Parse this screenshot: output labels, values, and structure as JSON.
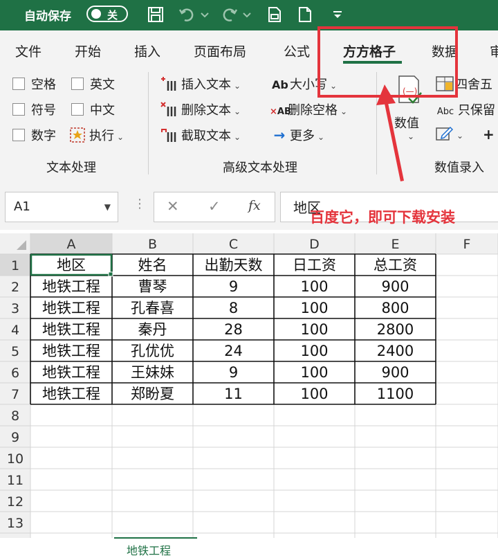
{
  "title_bar": {
    "autosave_label": "自动保存",
    "autosave_state": "关",
    "icons": [
      "save-icon",
      "undo-icon",
      "redo-icon",
      "print-icon",
      "new-file-icon",
      "more-icon"
    ]
  },
  "tabs": [
    {
      "label": "文件"
    },
    {
      "label": "开始"
    },
    {
      "label": "插入"
    },
    {
      "label": "页面布局"
    },
    {
      "label": "公式"
    },
    {
      "label": "方方格子",
      "active": true
    },
    {
      "label": "数据"
    },
    {
      "label": "审"
    }
  ],
  "ribbon": {
    "text_group": {
      "label": "文本处理",
      "checks": [
        "空格",
        "英文",
        "符号",
        "中文",
        "数字"
      ],
      "execute_label": "执行"
    },
    "advanced_group": {
      "label": "高级文本处理",
      "insert_text": "插入文本",
      "delete_text": "删除文本",
      "extract_text": "截取文本",
      "case_label": "大小写",
      "case_icon_text": "Ab",
      "delete_space": "删除空格",
      "delete_space_icon_text": "AB",
      "more_label": "更多"
    },
    "value_group": {
      "label": "数值录入",
      "value_label": "数值",
      "round_label": "四舍五",
      "keep_label": "只保留",
      "keep_icon_text": "Abc",
      "plus_label": "+"
    }
  },
  "formula_bar": {
    "name_box": "A1",
    "fx": "fx",
    "value": "地区"
  },
  "annotation": {
    "text": "百度它，即可下载安装",
    "color": "#e4343c"
  },
  "sheet": {
    "columns": [
      "A",
      "B",
      "C",
      "D",
      "E",
      "F"
    ],
    "row_numbers": [
      "1",
      "2",
      "3",
      "4",
      "5",
      "6",
      "7",
      "8",
      "9",
      "10",
      "11",
      "12",
      "13"
    ],
    "rows": [
      [
        "地区",
        "姓名",
        "出勤天数",
        "日工资",
        "总工资"
      ],
      [
        "地铁工程",
        "曹琴",
        "9",
        "100",
        "900"
      ],
      [
        "地铁工程",
        "孔春喜",
        "8",
        "100",
        "800"
      ],
      [
        "地铁工程",
        "秦丹",
        "28",
        "100",
        "2800"
      ],
      [
        "地铁工程",
        "孔优优",
        "24",
        "100",
        "2400"
      ],
      [
        "地铁工程",
        "王妹妹",
        "9",
        "100",
        "900"
      ],
      [
        "地铁工程",
        "郑盼夏",
        "11",
        "100",
        "1100"
      ]
    ],
    "active_tab": "地铁工程"
  },
  "colors": {
    "brand": "#1f7145",
    "highlight": "#e4343c"
  }
}
